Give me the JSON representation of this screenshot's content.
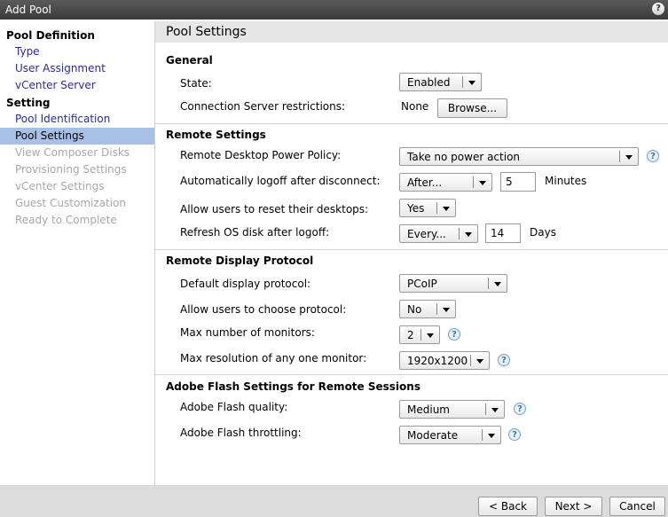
{
  "window": {
    "title": "Add Pool",
    "help_glyph": "?"
  },
  "sidebar": {
    "sections": [
      {
        "label": "Pool Definition",
        "items": [
          {
            "label": "Type",
            "state": "link"
          },
          {
            "label": "User Assignment",
            "state": "link"
          },
          {
            "label": "vCenter Server",
            "state": "link"
          }
        ]
      },
      {
        "label": "Setting",
        "items": [
          {
            "label": "Pool Identification",
            "state": "link"
          },
          {
            "label": "Pool Settings",
            "state": "selected"
          },
          {
            "label": "View Composer Disks",
            "state": "disabled"
          },
          {
            "label": "Provisioning Settings",
            "state": "disabled"
          },
          {
            "label": "vCenter Settings",
            "state": "disabled"
          },
          {
            "label": "Guest Customization",
            "state": "disabled"
          },
          {
            "label": "Ready to Complete",
            "state": "disabled"
          }
        ]
      }
    ]
  },
  "main": {
    "title": "Pool Settings",
    "general": {
      "title": "General",
      "state_label": "State:",
      "state_value": "Enabled",
      "conn_label": "Connection Server restrictions:",
      "conn_value": "None",
      "browse_label": "Browse..."
    },
    "remote": {
      "title": "Remote Settings",
      "power_label": "Remote Desktop Power Policy:",
      "power_value": "Take no power action",
      "logoff_label": "Automatically logoff after disconnect:",
      "logoff_value": "After...",
      "logoff_minutes": "5",
      "logoff_unit": "Minutes",
      "reset_label": "Allow users to reset their desktops:",
      "reset_value": "Yes",
      "refresh_label": "Refresh OS disk after logoff:",
      "refresh_value": "Every...",
      "refresh_days": "14",
      "refresh_unit": "Days"
    },
    "display": {
      "title": "Remote Display Protocol",
      "default_label": "Default display protocol:",
      "default_value": "PCoIP",
      "choose_label": "Allow users to choose protocol:",
      "choose_value": "No",
      "monitors_label": "Max number of monitors:",
      "monitors_value": "2",
      "resolution_label": "Max resolution of any one monitor:",
      "resolution_value": "1920x1200"
    },
    "flash": {
      "title": "Adobe Flash Settings for Remote Sessions",
      "quality_label": "Adobe Flash quality:",
      "quality_value": "Medium",
      "throttle_label": "Adobe Flash throttling:",
      "throttle_value": "Moderate"
    },
    "help_glyph": "?"
  },
  "footer": {
    "back_label": "< Back",
    "next_label": "Next >",
    "cancel_label": "Cancel"
  },
  "colors": {
    "selected_bg": "#a8c0e6",
    "link": "#2a2aa0",
    "disabled": "#a8a8a8",
    "titlebar": "#4a4a4a"
  }
}
